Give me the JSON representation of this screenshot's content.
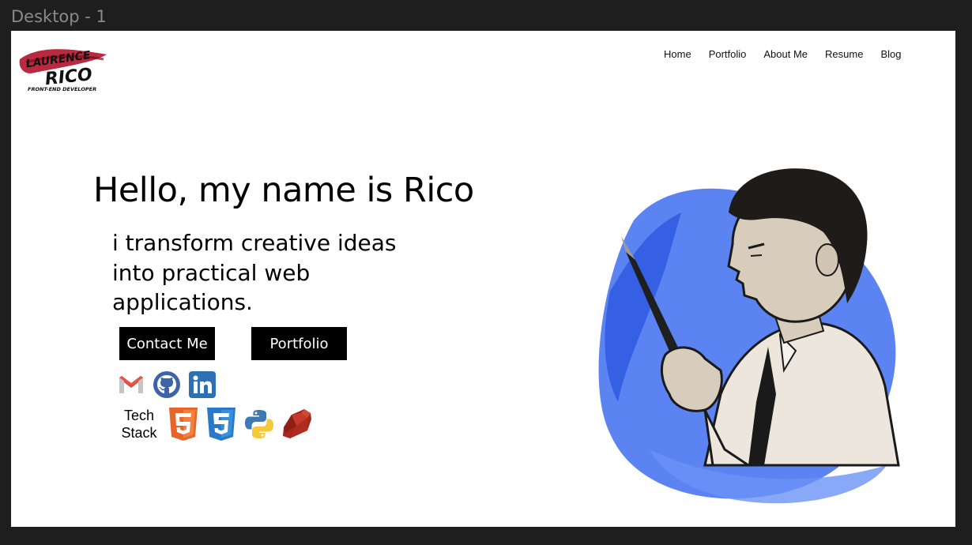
{
  "frame": {
    "title": "Desktop - 1"
  },
  "logo": {
    "line1": "LAURENCE",
    "line2": "RICO",
    "line3": "FRONT-END DEVELOPER",
    "accent_color": "#b3122a"
  },
  "nav": {
    "items": [
      {
        "label": "Home"
      },
      {
        "label": "Portfolio"
      },
      {
        "label": "About Me"
      },
      {
        "label": "Resume"
      },
      {
        "label": "Blog"
      }
    ]
  },
  "hero": {
    "title": "Hello, my name is Rico",
    "tagline": "i transform creative ideas into practical web applications.",
    "contact_button": "Contact Me",
    "portfolio_button": "Portfolio"
  },
  "socials": [
    {
      "icon": "gmail-icon"
    },
    {
      "icon": "github-icon"
    },
    {
      "icon": "linkedin-icon"
    }
  ],
  "tech_stack": {
    "label": "Tech Stack",
    "icons": [
      "html5-icon",
      "css3-icon",
      "python-icon",
      "ruby-icon"
    ]
  },
  "colors": {
    "brush_blue": "#3e6ef0",
    "button_bg": "#000000",
    "linkedin": "#2f6fb3",
    "github": "#3f63a8",
    "html5": "#e8652a",
    "css3": "#2b78c8"
  }
}
